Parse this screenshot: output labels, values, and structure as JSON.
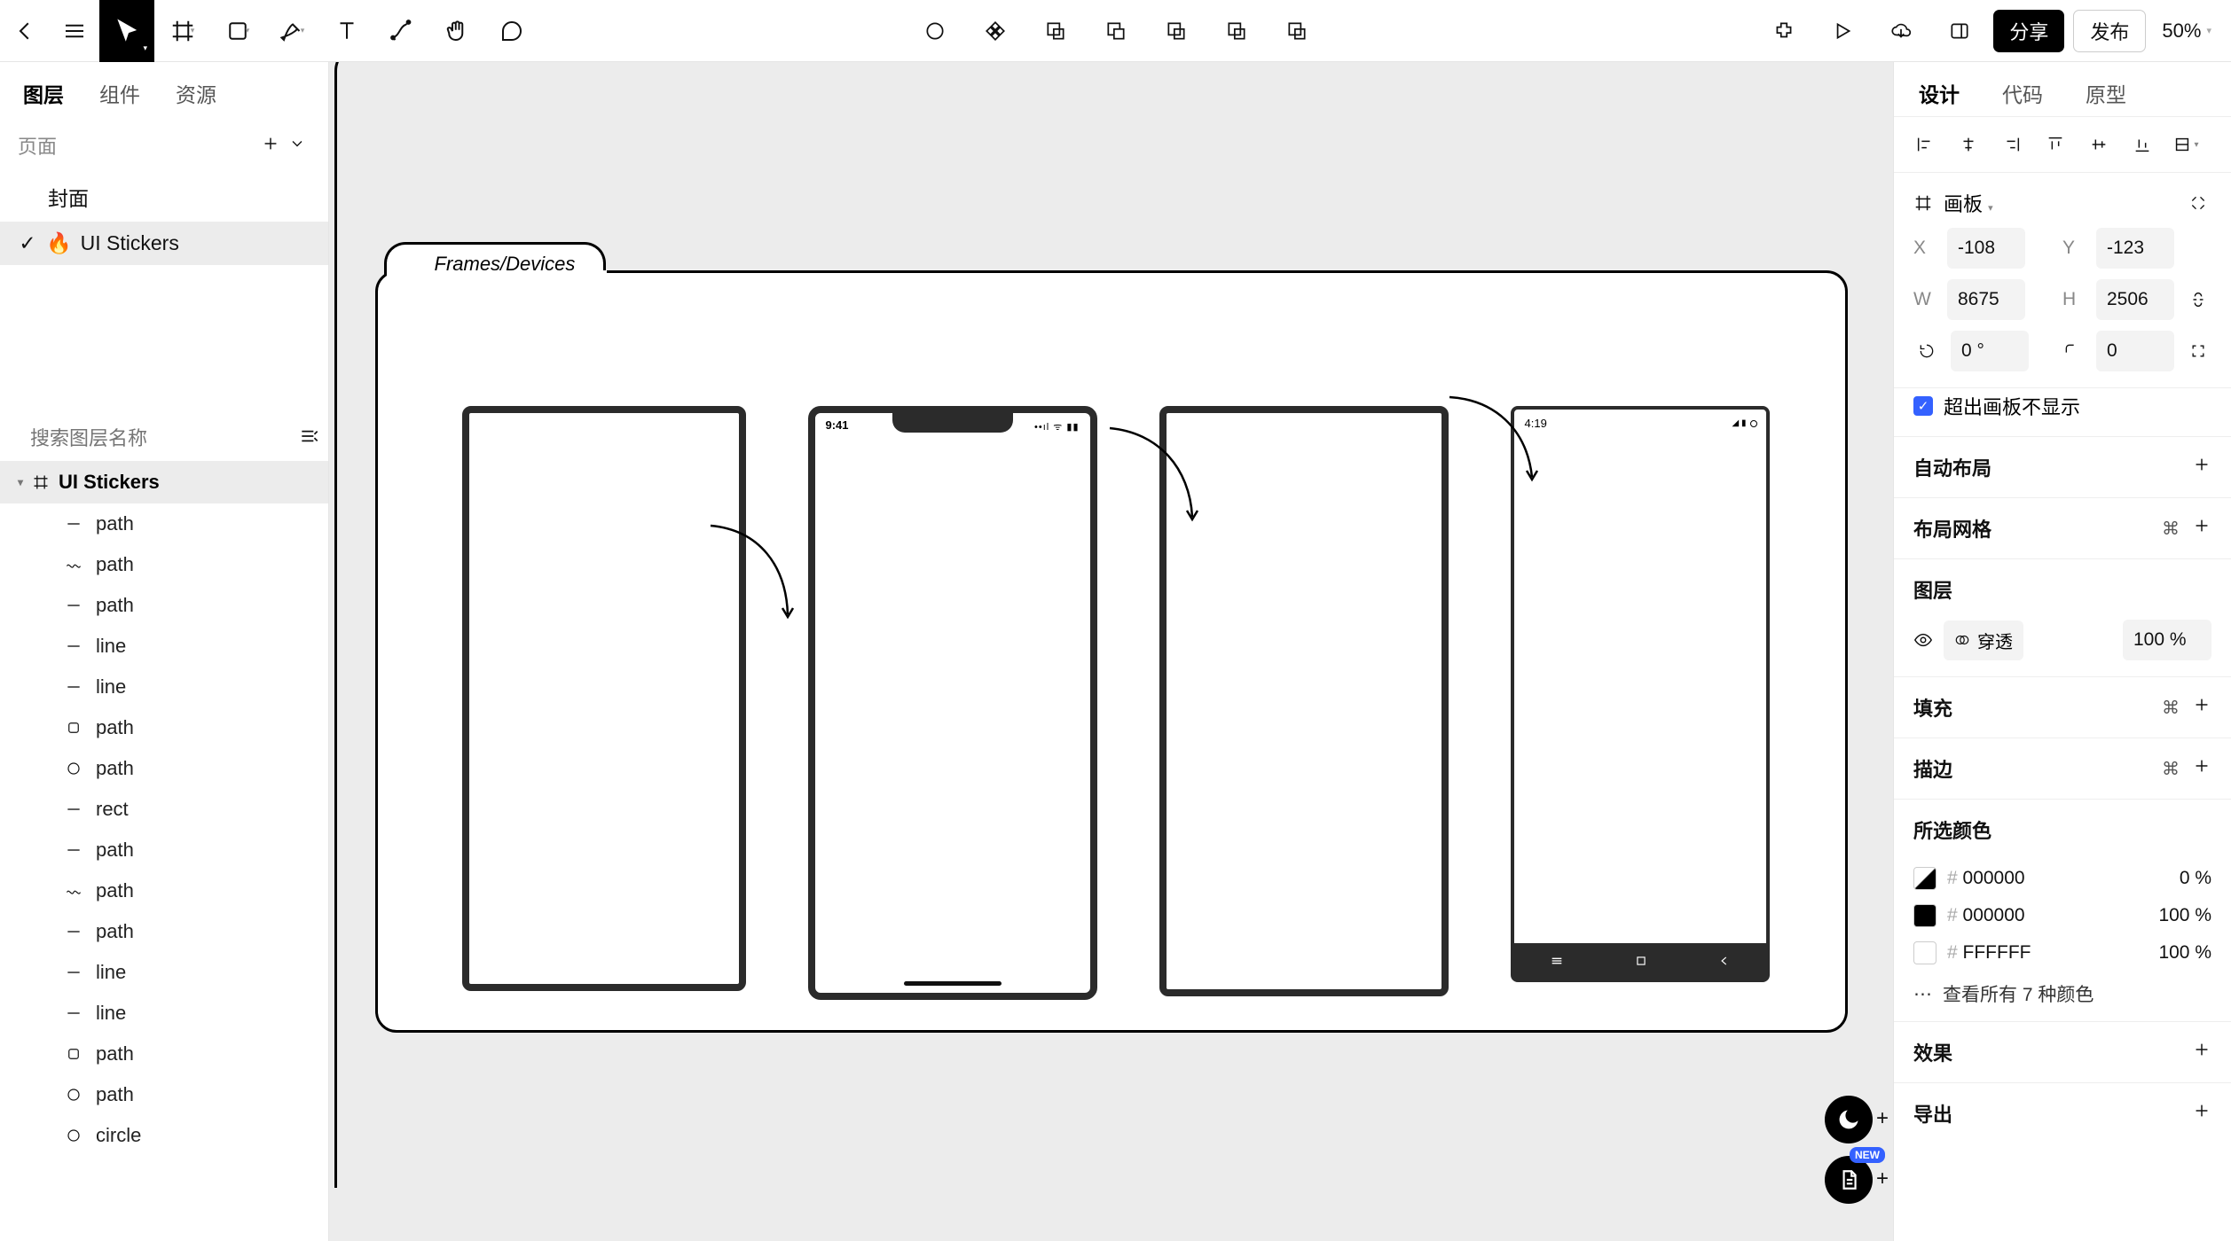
{
  "topbar": {
    "share_label": "分享",
    "publish_label": "发布",
    "zoom": "50%"
  },
  "left_panel": {
    "tabs": {
      "layers": "图层",
      "components": "组件",
      "assets": "资源"
    },
    "pages_label": "页面",
    "pages": [
      {
        "label": "封面",
        "selected": false,
        "sticker": ""
      },
      {
        "label": "UI Stickers",
        "selected": true,
        "sticker": "🔥"
      }
    ],
    "search_placeholder": "搜索图层名称",
    "root_layer": "UI Stickers",
    "layers": [
      {
        "name": "path",
        "icon": "line"
      },
      {
        "name": "path",
        "icon": "wave"
      },
      {
        "name": "path",
        "icon": "line"
      },
      {
        "name": "line",
        "icon": "line"
      },
      {
        "name": "line",
        "icon": "line"
      },
      {
        "name": "path",
        "icon": "rect"
      },
      {
        "name": "path",
        "icon": "circle"
      },
      {
        "name": "rect",
        "icon": "line"
      },
      {
        "name": "path",
        "icon": "line"
      },
      {
        "name": "path",
        "icon": "wave"
      },
      {
        "name": "path",
        "icon": "line"
      },
      {
        "name": "line",
        "icon": "line"
      },
      {
        "name": "line",
        "icon": "line"
      },
      {
        "name": "path",
        "icon": "rect"
      },
      {
        "name": "path",
        "icon": "circle"
      },
      {
        "name": "circle",
        "icon": "circle"
      }
    ]
  },
  "canvas": {
    "folder_label": "Frames/Devices",
    "ios_time": "9:41",
    "ios_signal": "📶 📡 🔋",
    "android_time": "4:19"
  },
  "right_panel": {
    "tabs": {
      "design": "设计",
      "code": "代码",
      "prototype": "原型"
    },
    "frame_type": "画板",
    "x": "-108",
    "y": "-123",
    "w": "8675",
    "h": "2506",
    "rotation": "0 °",
    "radius": "0",
    "clip_label": "超出画板不显示",
    "sections": {
      "auto_layout": "自动布局",
      "layout_grid": "布局网格",
      "layer": "图层",
      "fill": "填充",
      "stroke": "描边",
      "selection_colors": "所选颜色",
      "effects": "效果",
      "export": "导出"
    },
    "layer_blend": "穿透",
    "layer_opacity": "100 %",
    "colors": [
      {
        "hex": "000000",
        "pct": "0 %",
        "swatch_style": "background:linear-gradient(135deg,#fff 48%,#000 52%);"
      },
      {
        "hex": "000000",
        "pct": "100 %",
        "swatch_style": "background:#000;"
      },
      {
        "hex": "FFFFFF",
        "pct": "100 %",
        "swatch_style": "background:#fff;"
      }
    ],
    "see_all_colors": "查看所有 7 种颜色",
    "new_badge": "NEW"
  }
}
